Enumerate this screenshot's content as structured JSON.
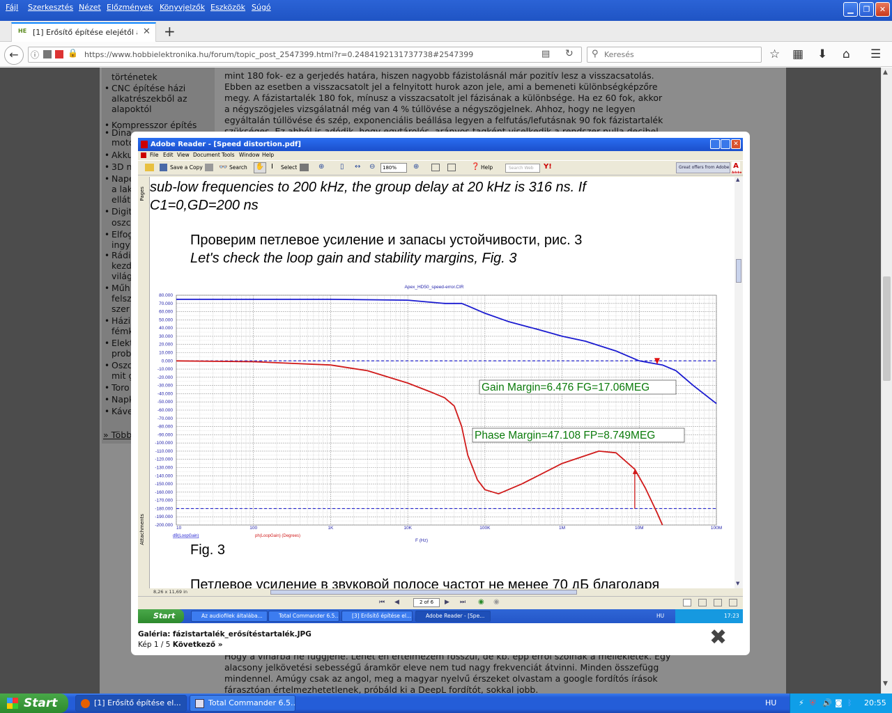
{
  "firefox": {
    "menu": [
      "Fájl",
      "Szerkesztés",
      "Nézet",
      "Előzmények",
      "Könyvjelzők",
      "Eszközök",
      "Súgó"
    ],
    "tab_title": "[1] Erősítő építése elejétől a ...",
    "tab_favicon": "HE",
    "url": "https://www.hobbielektronika.hu/forum/topic_post_2547399.html?r=0.2484192131737738#2547399",
    "search_placeholder": "Keresés"
  },
  "sidebar": {
    "items": [
      {
        "bullet": "",
        "text": "történetek"
      },
      {
        "bullet": "•",
        "text": "CNC építése házi alkatrészekből az alapoktól"
      },
      {
        "bullet": "•",
        "text": "Kompresszor építés"
      },
      {
        "bullet": "•",
        "text": "Dina"
      },
      {
        "bullet": "",
        "text": "moto"
      },
      {
        "bullet": "•",
        "text": "Akku"
      },
      {
        "bullet": "•",
        "text": "3D n"
      },
      {
        "bullet": "•",
        "text": "Nape"
      },
      {
        "bullet": "",
        "text": "a lak"
      },
      {
        "bullet": "",
        "text": "ellát"
      },
      {
        "bullet": "•",
        "text": "Digit"
      },
      {
        "bullet": "",
        "text": "oszc"
      },
      {
        "bullet": "•",
        "text": "Elfog"
      },
      {
        "bullet": "",
        "text": "ingy"
      },
      {
        "bullet": "•",
        "text": "Rádi"
      },
      {
        "bullet": "",
        "text": "kezd"
      },
      {
        "bullet": "",
        "text": "világ"
      },
      {
        "bullet": "•",
        "text": "Műh"
      },
      {
        "bullet": "",
        "text": "felsz"
      },
      {
        "bullet": "",
        "text": "szer"
      },
      {
        "bullet": "•",
        "text": "Házi"
      },
      {
        "bullet": "",
        "text": "fémk"
      },
      {
        "bullet": "•",
        "text": "Elekt"
      },
      {
        "bullet": "",
        "text": "prob"
      },
      {
        "bullet": "•",
        "text": "Oszc"
      },
      {
        "bullet": "",
        "text": "mit g"
      },
      {
        "bullet": "•",
        "text": "Toro"
      },
      {
        "bullet": "•",
        "text": "Napk"
      },
      {
        "bullet": "•",
        "text": "Káve"
      }
    ],
    "more_link": "» Több"
  },
  "article": {
    "top_lines": [
      "mint 180 fok- ez a gerjedés határa, hiszen nagyobb fázistolásnál már pozitív lesz a visszacsatolás.",
      "Ebben az esetben a visszacsatolt jel a felnyitott hurok azon jele, ami a bemeneti különbségképzőre",
      "megy. A fázistartalék 180 fok, mínusz a visszacsatolt jel fázisának a különbsége. Ha ez 60 fok, akkor",
      "a négyszögjeles vizsgálatnál még van 4 % túllövése a négyszögjelnek. Ahhoz, hogy ne legyen",
      "egyáltalán túllövése és szép, exponenciális beállása legyen a felfutás/lefutásnak 90 fok fázistartalék",
      "szükséges. Ez abból is adódik, hogy egytárolós, arányos tagként viselkedik a rendszer nulla decibel"
    ],
    "bottom_lines": [
      "Hogy a vinarba ne függjene. Lehet én értelmezem rosszul, de kb. épp erről szólnak a mellékletek. Egy",
      "alacsony jelkövetési sebességű áramkör eleve nem tud nagy frekvenciát átvinni. Minden összefügg",
      "mindennel. Amúgy csak az angol, meg a magyar nyelvű érszeket olvastam a google fordítós írások",
      "fárasztóan értelmezhetetlenek, próbáld ki a DeepL fordítót, sokkal jobb."
    ]
  },
  "reader": {
    "title": "Adobe Reader - [Speed distortion.pdf]",
    "menu": [
      "File",
      "Edit",
      "View",
      "Document",
      "Tools",
      "Window",
      "Help"
    ],
    "tools": {
      "save_copy": "Save a Copy",
      "search": "Search",
      "select": "Select",
      "zoom": "180%",
      "help": "Help",
      "search_web": "Search Web",
      "offer": "Great offers from Adobe",
      "adobe_label": "Adobe"
    },
    "side_tabs": {
      "pages": "Pages",
      "attachments": "Attachments"
    },
    "doc": {
      "line1": "sub-low frequencies to 200 kHz, the group delay at 20 kHz is 316 ns. If",
      "line2": "C1=0,GD=200 ns",
      "ru1": "Проверим петлевое усиление и запасы устойчивости, рис. 3",
      "en1": "Let's check the loop gain and stability margins, Fig. 3",
      "fig": "Fig. 3",
      "ru2": "Петлевое усиление в звуковой полосе частот не менее 70 дБ благодаря"
    },
    "page_size": "8,26 x 11,69 in",
    "page_indicator": "2 of 6"
  },
  "chart_data": {
    "type": "line",
    "title": "Apex_HD50_speed-error.CIR",
    "xlabel": "F (Hz)",
    "xscale": "log",
    "xlim": [
      10,
      100000000
    ],
    "ylim": [
      -200,
      80
    ],
    "x_ticks": [
      10,
      100,
      1000,
      10000,
      100000,
      1000000,
      10000000,
      100000000
    ],
    "x_tick_labels": [
      "10",
      "100",
      "1K",
      "10K",
      "100K",
      "1M",
      "10M",
      "100M"
    ],
    "y_ticks": [
      80,
      70,
      60,
      50,
      40,
      30,
      20,
      10,
      0,
      -10,
      -20,
      -30,
      -40,
      -50,
      -60,
      -70,
      -80,
      -90,
      -100,
      -110,
      -120,
      -130,
      -140,
      -150,
      -160,
      -170,
      -180,
      -190,
      -200
    ],
    "y_tick_labels": [
      "80.000",
      "70.000",
      "60.000",
      "50.000",
      "40.000",
      "30.000",
      "20.000",
      "10.000",
      "0.000",
      "-10.000",
      "-20.000",
      "-30.000",
      "-40.000",
      "-50.000",
      "-60.000",
      "-70.000",
      "-80.000",
      "-90.000",
      "-100.000",
      "-110.000",
      "-120.000",
      "-130.000",
      "-140.000",
      "-150.000",
      "-160.000",
      "-170.000",
      "-180.000",
      "-190.000",
      "-200.000"
    ],
    "grid": true,
    "series": [
      {
        "name": "dB(LoopGain)",
        "color": "#1a1ad0",
        "x": [
          10,
          100,
          1000,
          10000,
          30000,
          50000,
          60000,
          100000,
          200000,
          500000,
          1000000,
          2000000,
          5000000,
          10000000,
          20000000,
          30000000,
          50000000,
          100000000
        ],
        "y": [
          75,
          75,
          75,
          74,
          70,
          70,
          67,
          58,
          48,
          38,
          30,
          24,
          12,
          0,
          -5,
          -12,
          -30,
          -52
        ]
      },
      {
        "name": "ph(LoopGain) (Degrees)",
        "color": "#d01a1a",
        "x": [
          10,
          100,
          1000,
          3000,
          10000,
          20000,
          30000,
          40000,
          50000,
          60000,
          80000,
          100000,
          150000,
          300000,
          1000000,
          3000000,
          5000000,
          8749000,
          12000000,
          17000000,
          20000000
        ],
        "y": [
          0,
          -1,
          -5,
          -12,
          -27,
          -38,
          -45,
          -55,
          -80,
          -115,
          -145,
          -157,
          -162,
          -150,
          -125,
          -110,
          -112,
          -132,
          -155,
          -185,
          -200
        ]
      }
    ],
    "reference_lines": [
      0,
      -180
    ],
    "annotations": [
      {
        "text": "Gain Margin=6.476 FG=17.06MEG",
        "color": "#0a7a0a"
      },
      {
        "text": "Phase Margin=47.108 FP=8.749MEG",
        "color": "#0a7a0a"
      }
    ],
    "markers": [
      {
        "x": 17060000,
        "y": 0,
        "kind": "gain-margin-triangle"
      },
      {
        "x": 8749000,
        "y_from": -180,
        "y_to": -132,
        "kind": "phase-margin-arrow"
      }
    ]
  },
  "inner_taskbar": {
    "start": "Start",
    "items": [
      "Az audiofilek általába...",
      "Total Commander 6.5...",
      "[3] Erősítő építése el...",
      "Adobe Reader - [Spe..."
    ],
    "lang": "HU",
    "clock": "17:23"
  },
  "gallery": {
    "label": "Galéria:",
    "filename": "fázistartalék_erősítéstartalék.JPG",
    "counter": "Kép 1 / 5",
    "next": "Következő »"
  },
  "taskbar": {
    "start": "Start",
    "items": [
      "[1] Erősítő építése el...",
      "Total Commander 6.5..."
    ],
    "lang": "HU",
    "clock": "20:55"
  }
}
